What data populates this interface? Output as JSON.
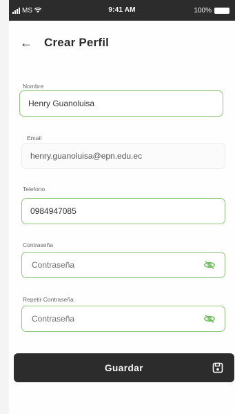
{
  "status_bar": {
    "carrier": "MS",
    "time": "9:41 AM",
    "battery": "100%"
  },
  "header": {
    "title": "Crear Perfil",
    "back_icon": "arrow-left-icon"
  },
  "form": {
    "nombre": {
      "label": "Nombre",
      "value": "Henry Guanoluisa"
    },
    "email": {
      "label": "Email",
      "value": "henry.guanoluisa@epn.edu.ec"
    },
    "telefono": {
      "label": "Telefono",
      "value": "0984947085"
    },
    "contrasena": {
      "label": "Contraseña",
      "placeholder": "Contraseña",
      "icon": "eye-off-icon"
    },
    "repetir_contrasena": {
      "label": "Repetir Contraseña",
      "placeholder": "Contraseña",
      "icon": "eye-off-icon"
    }
  },
  "save_button": {
    "label": "Guardar",
    "icon": "save-icon"
  },
  "colors": {
    "accent_green": "#8cc976",
    "dark": "#2c2c2c"
  }
}
